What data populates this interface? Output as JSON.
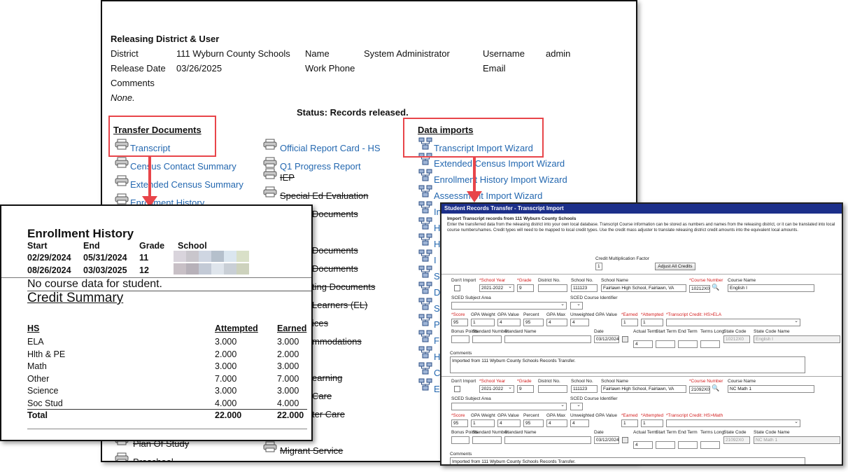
{
  "releasing": {
    "heading": "Releasing District & User",
    "district_label": "District",
    "district_value": "111 Wyburn County Schools",
    "name_label": "Name",
    "name_value": "System Administrator",
    "username_label": "Username",
    "username_value": "admin",
    "release_date_label": "Release Date",
    "release_date_value": "03/26/2025",
    "work_phone_label": "Work Phone",
    "email_label": "Email",
    "comments_label": "Comments",
    "comments_value": "None."
  },
  "status": "Status: Records released.",
  "transfer_documents": {
    "heading": "Transfer Documents",
    "items": [
      "Transcript",
      "Census Contact Summary",
      "Extended Census Summary",
      "Enrollment History",
      "Plan Of Study",
      "Preschool"
    ]
  },
  "middle_documents": {
    "items": [
      "Official Report Card - HS",
      "Q1 Progress Report",
      "IEP",
      "Special Ed Evaluation",
      "Documents",
      "Documents",
      "Documents",
      "ting Documents",
      "Learners (EL)",
      "ices",
      "mmodations",
      "earning",
      "Care",
      "ter Care",
      "Migrant Service"
    ]
  },
  "data_imports": {
    "heading": "Data imports",
    "items": [
      "Transcript Import Wizard",
      "Extended Census Import Wizard",
      "Enrollment History Import Wizard",
      "Assessment Import Wizard",
      "In",
      "H",
      "H",
      "I",
      "S",
      "D",
      "S",
      "P",
      "F",
      "H",
      "C",
      "E"
    ]
  },
  "enrollment": {
    "title": "Enrollment History",
    "headers": [
      "Start",
      "End",
      "Grade",
      "School"
    ],
    "rows": [
      {
        "start": "02/29/2024",
        "end": "05/31/2024",
        "grade": "11"
      },
      {
        "start": "08/26/2024",
        "end": "03/03/2025",
        "grade": "12"
      }
    ],
    "no_course": "No course data for student.",
    "credit_title": "Credit Summary",
    "credit_headers": [
      "HS",
      "Attempted",
      "Earned"
    ],
    "credit_rows": [
      {
        "name": "ELA",
        "attempted": "3.000",
        "earned": "3.000"
      },
      {
        "name": "Hlth & PE",
        "attempted": "2.000",
        "earned": "2.000"
      },
      {
        "name": "Math",
        "attempted": "3.000",
        "earned": "3.000"
      },
      {
        "name": "Other",
        "attempted": "7.000",
        "earned": "7.000"
      },
      {
        "name": "Science",
        "attempted": "3.000",
        "earned": "3.000"
      },
      {
        "name": "Soc Stud",
        "attempted": "4.000",
        "earned": "4.000"
      }
    ],
    "total": {
      "name": "Total",
      "attempted": "22.000",
      "earned": "22.000"
    }
  },
  "transcript_wizard": {
    "title": "Student Records Transfer - Transcript Import",
    "subtitle": "Import Transcript records from 111 Wyburn County Schools",
    "description": "Enter the transferred data from the releasing district into your own local database. Transcript Course information can be stored as numbers and names from the releasing district, or it can be translated into local course numbers/names. Credit types will need to be mapped to local credit types. Use the credit mass adjuster to translate releasing district credit amounts into the equivalent local amounts.",
    "credit_factor_label": "Credit Multiplication Factor",
    "credit_factor_value": "1",
    "adjust_button": "Adjust All Credits",
    "labels": {
      "dont_import": "Don't Import",
      "school_year": "*School Year",
      "grade": "*Grade",
      "district_no": "District No.",
      "school_no": "School No.",
      "school_name": "School Name",
      "course_number": "*Course Number",
      "course_name": "Course Name",
      "sced_subject": "SCED Subject Area",
      "sced_course": "SCED Course Identifier",
      "score": "*Score",
      "gpa_weight": "GPA Weight",
      "gpa_value": "GPA Value",
      "percent": "Percent",
      "gpa_max": "GPA Max",
      "unweighted_gpa": "Unweighted GPA Value",
      "earned": "*Earned",
      "attempted": "*Attempted",
      "bonus_points": "Bonus Points",
      "standard_number": "Standard Number",
      "standard_name": "Standard Name",
      "date": "Date",
      "actual_term": "Actual Term",
      "start_term": "Start Term",
      "end_term": "End Term",
      "terms_long": "Terms Long",
      "state_code": "State Code",
      "state_code_name": "State Code Name",
      "comments": "Comments"
    },
    "records": [
      {
        "school_year": "2021-2022",
        "grade": "9",
        "school_no": "111123",
        "school_name": "Fairlawn High School, Fairlawn, VA",
        "course_number": "10212X0",
        "course_name": "English I",
        "transcript_credit_label": "*Transcript Credit: HS>ELA",
        "score": "95",
        "gpa_weight": "1",
        "gpa_value": "4",
        "percent": "95",
        "gpa_max": "4",
        "unweighted_gpa": "4",
        "earned": "1",
        "attempted": "1",
        "date": "03/12/2024",
        "actual_term": "4",
        "state_code": "10212X0",
        "state_code_name": "English I",
        "comments": "Imported from 111 Wyburn County Schools Records Transfer."
      },
      {
        "school_year": "2021-2022",
        "grade": "9",
        "school_no": "111123",
        "school_name": "Fairlawn High School, Fairlawn, VA",
        "course_number": "21092X0",
        "course_name": "NC Math 1",
        "transcript_credit_label": "*Transcript Credit: HS>Math",
        "score": "95",
        "gpa_weight": "1",
        "gpa_value": "4",
        "percent": "95",
        "gpa_max": "4",
        "unweighted_gpa": "4",
        "earned": "1",
        "attempted": "1",
        "date": "03/12/2024",
        "actual_term": "4",
        "state_code": "21092X0",
        "state_code_name": "NC Math 1",
        "comments": "Imported from 111 Wyburn County Schools Records Transfer."
      }
    ]
  },
  "colors": {
    "link": "#2468b0",
    "callout": "#e8454a",
    "wizard_title_bar": "#1c2f8a",
    "required_label": "#d42020"
  }
}
